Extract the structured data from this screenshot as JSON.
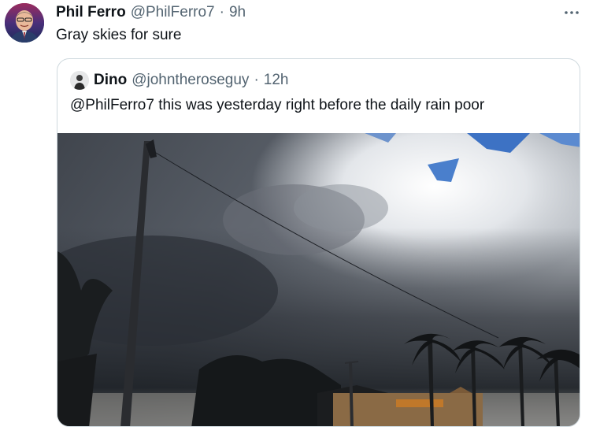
{
  "tweet": {
    "author_name": "Phil Ferro",
    "author_handle": "@PhilFerro7",
    "separator": "·",
    "time": "9h",
    "text": "Gray skies for sure",
    "more_icon": "more-horizontal-icon"
  },
  "quoted_tweet": {
    "author_name": "Dino",
    "author_handle": "@johntheroseguy",
    "separator": "·",
    "time": "12h",
    "text": "@PhilFerro7 this was yesterday right before the daily rain poor"
  },
  "colors": {
    "text_primary": "#0f1419",
    "text_secondary": "#536471",
    "border": "#cfd9de"
  }
}
